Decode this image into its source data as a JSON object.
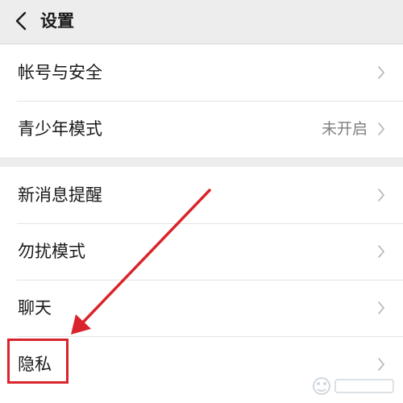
{
  "header": {
    "title": "设置"
  },
  "group1": [
    {
      "label": "帐号与安全",
      "value": ""
    },
    {
      "label": "青少年模式",
      "value": "未开启"
    }
  ],
  "group2": [
    {
      "label": "新消息提醒",
      "value": ""
    },
    {
      "label": "勿扰模式",
      "value": ""
    },
    {
      "label": "聊天",
      "value": ""
    },
    {
      "label": "隐私",
      "value": ""
    }
  ],
  "annotation": {
    "color": "#d9242b"
  },
  "colors": {
    "background": "#ededed",
    "panel": "#ffffff",
    "secondary_text": "#7f7f7f"
  },
  "icons": {
    "back": "chevron-left-icon",
    "row": "chevron-right-icon"
  }
}
